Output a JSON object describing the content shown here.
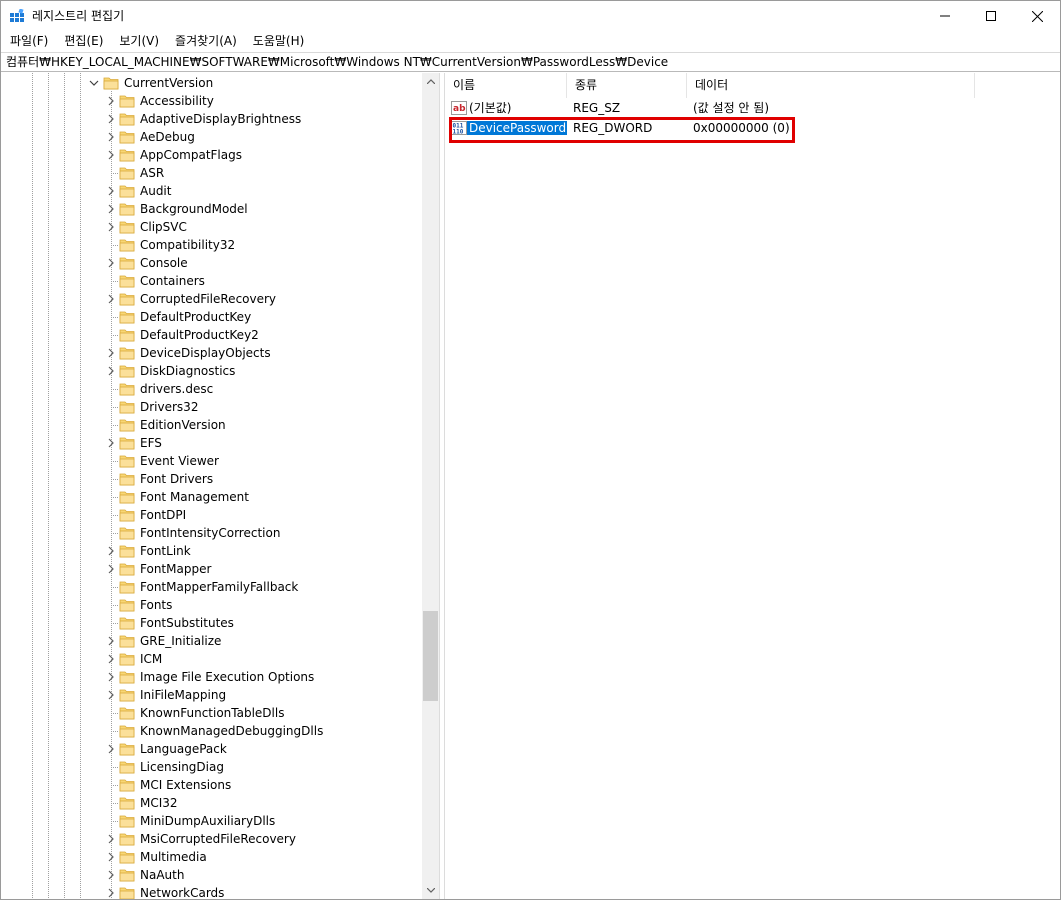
{
  "window": {
    "title": "레지스트리 편집기",
    "icon": "regedit-icon"
  },
  "menu": [
    "파일(F)",
    "편집(E)",
    "보기(V)",
    "즐겨찾기(A)",
    "도움말(H)"
  ],
  "address": "컴퓨터₩HKEY_LOCAL_MACHINE₩SOFTWARE₩Microsoft₩Windows NT₩CurrentVersion₩PasswordLess₩Device",
  "tree": {
    "parent": "CurrentVersion",
    "children": [
      {
        "label": "Accessibility",
        "expandable": true
      },
      {
        "label": "AdaptiveDisplayBrightness",
        "expandable": true
      },
      {
        "label": "AeDebug",
        "expandable": true
      },
      {
        "label": "AppCompatFlags",
        "expandable": true
      },
      {
        "label": "ASR",
        "expandable": false
      },
      {
        "label": "Audit",
        "expandable": true
      },
      {
        "label": "BackgroundModel",
        "expandable": true
      },
      {
        "label": "ClipSVC",
        "expandable": true
      },
      {
        "label": "Compatibility32",
        "expandable": false
      },
      {
        "label": "Console",
        "expandable": true
      },
      {
        "label": "Containers",
        "expandable": false
      },
      {
        "label": "CorruptedFileRecovery",
        "expandable": true
      },
      {
        "label": "DefaultProductKey",
        "expandable": false
      },
      {
        "label": "DefaultProductKey2",
        "expandable": false
      },
      {
        "label": "DeviceDisplayObjects",
        "expandable": true
      },
      {
        "label": "DiskDiagnostics",
        "expandable": true
      },
      {
        "label": "drivers.desc",
        "expandable": false
      },
      {
        "label": "Drivers32",
        "expandable": false
      },
      {
        "label": "EditionVersion",
        "expandable": false
      },
      {
        "label": "EFS",
        "expandable": true
      },
      {
        "label": "Event Viewer",
        "expandable": false
      },
      {
        "label": "Font Drivers",
        "expandable": false
      },
      {
        "label": "Font Management",
        "expandable": false
      },
      {
        "label": "FontDPI",
        "expandable": false
      },
      {
        "label": "FontIntensityCorrection",
        "expandable": false
      },
      {
        "label": "FontLink",
        "expandable": true
      },
      {
        "label": "FontMapper",
        "expandable": true
      },
      {
        "label": "FontMapperFamilyFallback",
        "expandable": false
      },
      {
        "label": "Fonts",
        "expandable": false
      },
      {
        "label": "FontSubstitutes",
        "expandable": false
      },
      {
        "label": "GRE_Initialize",
        "expandable": true
      },
      {
        "label": "ICM",
        "expandable": true
      },
      {
        "label": "Image File Execution Options",
        "expandable": true
      },
      {
        "label": "IniFileMapping",
        "expandable": true
      },
      {
        "label": "KnownFunctionTableDlls",
        "expandable": false
      },
      {
        "label": "KnownManagedDebuggingDlls",
        "expandable": false
      },
      {
        "label": "LanguagePack",
        "expandable": true
      },
      {
        "label": "LicensingDiag",
        "expandable": false
      },
      {
        "label": "MCI Extensions",
        "expandable": false
      },
      {
        "label": "MCI32",
        "expandable": false
      },
      {
        "label": "MiniDumpAuxiliaryDlls",
        "expandable": false
      },
      {
        "label": "MsiCorruptedFileRecovery",
        "expandable": true
      },
      {
        "label": "Multimedia",
        "expandable": true
      },
      {
        "label": "NaAuth",
        "expandable": true
      },
      {
        "label": "NetworkCards",
        "expandable": true
      }
    ]
  },
  "list": {
    "columns": {
      "name": "이름",
      "type": "종류",
      "data": "데이터"
    },
    "rows": [
      {
        "name": "(기본값)",
        "type": "REG_SZ",
        "data": "(값 설정 안 됨)",
        "icon": "string-value-icon"
      },
      {
        "name": "DevicePassword...",
        "type": "REG_DWORD",
        "data": "0x00000000 (0)",
        "icon": "binary-value-icon"
      }
    ]
  },
  "colors": {
    "selection": "#0078d7",
    "highlight_box": "#e00000",
    "folder": "#f8d775"
  }
}
